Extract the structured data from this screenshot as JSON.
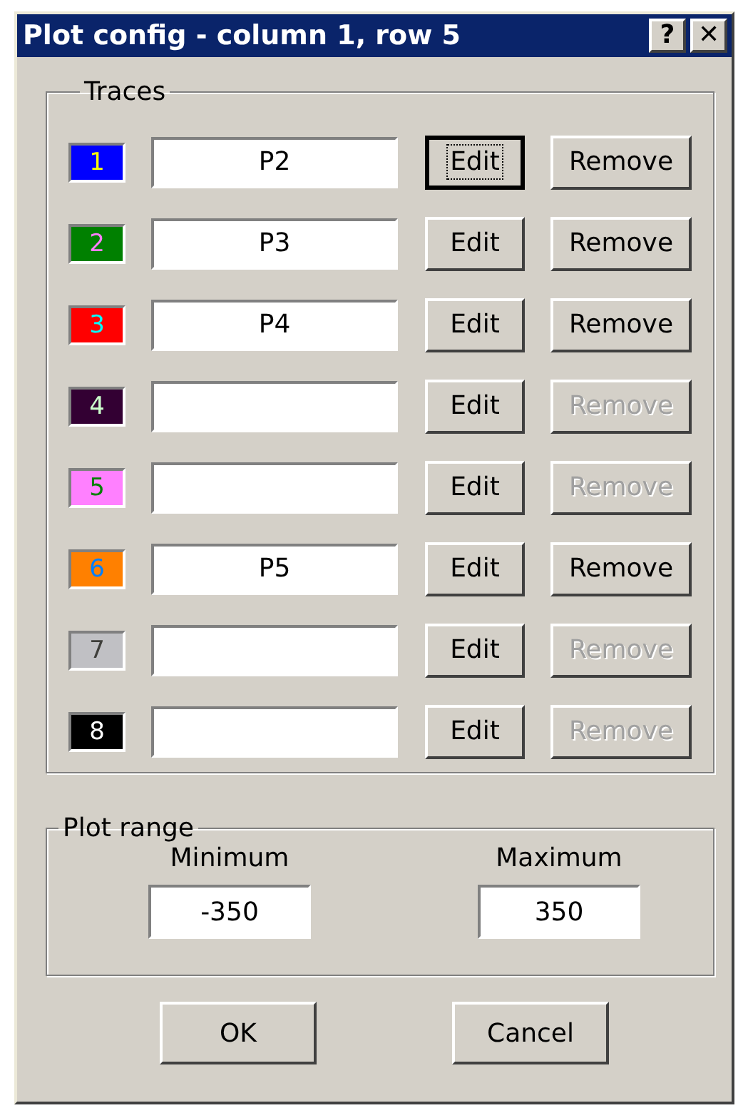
{
  "window": {
    "title": "Plot config - column 1, row 5",
    "title_buttons": [
      "?",
      "✕"
    ]
  },
  "traces": {
    "legend": "Traces",
    "rows": [
      {
        "number": "1",
        "color": "#0000ff",
        "name": "P2",
        "edit": "Edit",
        "edit_focused": true,
        "remove": "Remove",
        "remove_disabled": false
      },
      {
        "number": "2",
        "color": "#008000",
        "name": "P3",
        "edit": "Edit",
        "edit_focused": false,
        "remove": "Remove",
        "remove_disabled": false
      },
      {
        "number": "3",
        "color": "#ff0000",
        "name": "P4",
        "edit": "Edit",
        "edit_focused": false,
        "remove": "Remove",
        "remove_disabled": false
      },
      {
        "number": "4",
        "color": "#330033",
        "name": "",
        "edit": "Edit",
        "edit_focused": false,
        "remove": "Remove",
        "remove_disabled": true
      },
      {
        "number": "5",
        "color": "#ff80ff",
        "name": "",
        "edit": "Edit",
        "edit_focused": false,
        "remove": "Remove",
        "remove_disabled": true
      },
      {
        "number": "6",
        "color": "#ff8000",
        "name": "P5",
        "edit": "Edit",
        "edit_focused": false,
        "remove": "Remove",
        "remove_disabled": false
      },
      {
        "number": "7",
        "color": "#c0c0c4",
        "name": "",
        "edit": "Edit",
        "edit_focused": false,
        "remove": "Remove",
        "remove_disabled": true
      },
      {
        "number": "8",
        "color": "#000000",
        "name": "",
        "edit": "Edit",
        "edit_focused": false,
        "remove": "Remove",
        "remove_disabled": true
      }
    ]
  },
  "plot_range": {
    "legend": "Plot range",
    "fields": [
      {
        "label": "Minimum",
        "value": "-350"
      },
      {
        "label": "Maximum",
        "value": "350"
      }
    ]
  },
  "buttons": [
    "OK",
    "Cancel"
  ]
}
